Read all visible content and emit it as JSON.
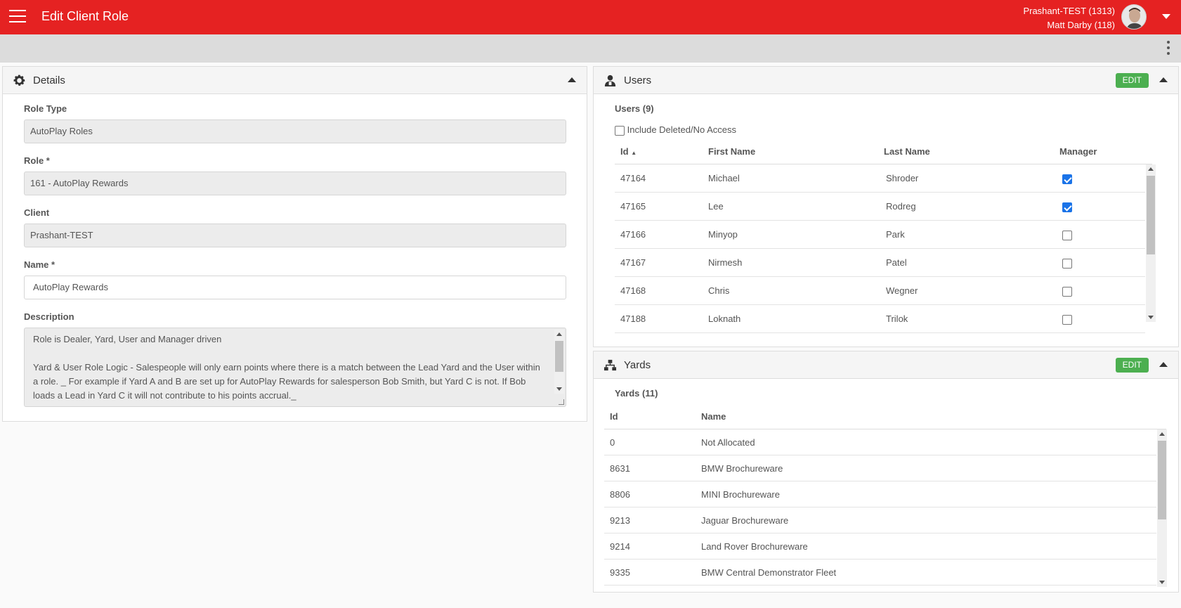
{
  "topbar": {
    "title": "Edit Client Role",
    "client_line": "Prashant-TEST (1313)",
    "user_line": "Matt Darby (118)"
  },
  "details": {
    "title": "Details",
    "icon": "gear-icon",
    "role_type_label": "Role Type",
    "role_type_value": "AutoPlay Roles",
    "role_label": "Role *",
    "role_value": "161 - AutoPlay Rewards",
    "client_label": "Client",
    "client_value": "Prashant-TEST",
    "name_label": "Name *",
    "name_value": "AutoPlay Rewards",
    "description_label": "Description",
    "description_p1": "Role is Dealer, Yard, User and Manager driven",
    "description_p2": "Yard & User Role Logic - Salespeople will only earn points where there is a match between the Lead Yard and the User within a role. _ For example if Yard A and B are set up for AutoPlay Rewards for salesperson Bob Smith, but Yard C is not. If Bob loads a Lead in Yard C it will not contribute to his points accrual._"
  },
  "users": {
    "title": "Users",
    "icon": "user-icon",
    "edit_label": "EDIT",
    "count_label": "Users (9)",
    "include_deleted_label": "Include Deleted/No Access",
    "headers": {
      "id": "Id",
      "sort_indicator": "▲",
      "first": "First Name",
      "last": "Last Name",
      "manager": "Manager"
    },
    "rows": [
      {
        "id": "47164",
        "first": "Michael",
        "last": "Shroder",
        "manager": true
      },
      {
        "id": "47165",
        "first": "Lee",
        "last": "Rodreg",
        "manager": true
      },
      {
        "id": "47166",
        "first": "Minyop",
        "last": "Park",
        "manager": false
      },
      {
        "id": "47167",
        "first": "Nirmesh",
        "last": "Patel",
        "manager": false
      },
      {
        "id": "47168",
        "first": "Chris",
        "last": "Wegner",
        "manager": false
      },
      {
        "id": "47188",
        "first": "Loknath",
        "last": "Trilok",
        "manager": false
      }
    ]
  },
  "yards": {
    "title": "Yards",
    "icon": "yard-network-icon",
    "edit_label": "EDIT",
    "count_label": "Yards (11)",
    "headers": {
      "id": "Id",
      "name": "Name"
    },
    "rows": [
      {
        "id": "0",
        "name": "Not Allocated"
      },
      {
        "id": "8631",
        "name": "BMW Brochureware"
      },
      {
        "id": "8806",
        "name": "MINI Brochureware"
      },
      {
        "id": "9213",
        "name": "Jaguar Brochureware"
      },
      {
        "id": "9214",
        "name": "Land Rover Brochureware"
      },
      {
        "id": "9335",
        "name": "BMW Central Demonstrator Fleet"
      }
    ]
  },
  "colors": {
    "topbar": "#e52222",
    "edit_button": "#4caf50",
    "checkbox_checked": "#1a73e8"
  }
}
